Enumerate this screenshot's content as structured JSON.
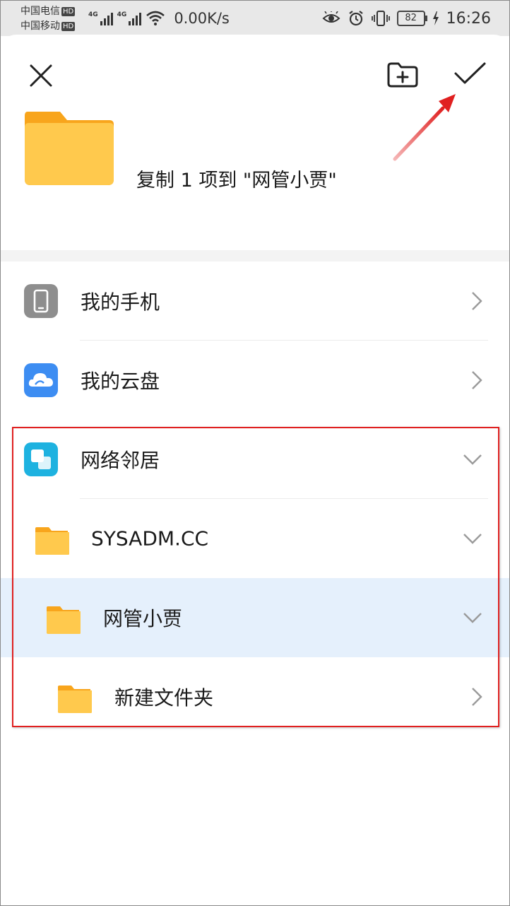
{
  "status_bar": {
    "carrier1": "中国电信",
    "carrier2": "中国移动",
    "hd_badge": "HD",
    "net_type": "4G",
    "speed": "0.00K/s",
    "battery": "82",
    "time": "16:26"
  },
  "dialog": {
    "title": "复制 1 项到 \"网管小贾\""
  },
  "locations": [
    {
      "label": "我的手机",
      "icon": "phone-icon",
      "expanded": false
    },
    {
      "label": "我的云盘",
      "icon": "cloud-icon",
      "expanded": false
    },
    {
      "label": "网络邻居",
      "icon": "network-icon",
      "expanded": true
    }
  ],
  "tree": [
    {
      "label": "SYSADM.CC",
      "icon": "folder-icon",
      "expanded": true,
      "selected": false
    },
    {
      "label": "网管小贾",
      "icon": "folder-icon",
      "expanded": true,
      "selected": true
    },
    {
      "label": "新建文件夹",
      "icon": "folder-icon",
      "expanded": false,
      "selected": false
    }
  ],
  "colors": {
    "folder": "#FFC94D",
    "folder_tab": "#F8A51C",
    "selected_row": "#E5F0FC",
    "cloud_blue": "#3D8DF2",
    "network_cyan": "#1EB2E0",
    "phone_gray": "#8E8E8E",
    "annotation_red": "#E02020"
  }
}
